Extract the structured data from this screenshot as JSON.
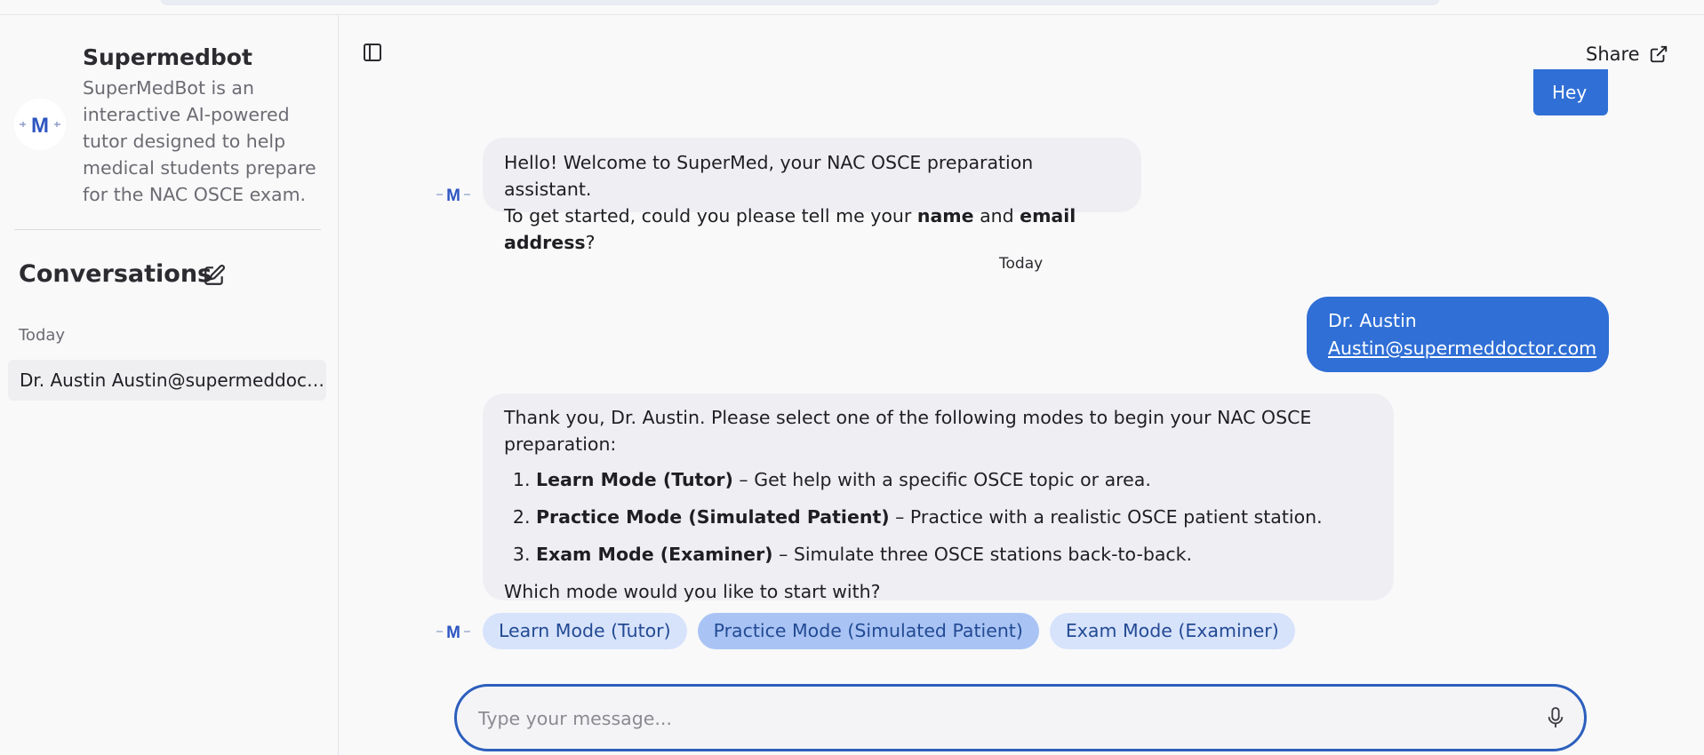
{
  "sidebar": {
    "bot_name": "Supermedbot",
    "bot_description": "SuperMedBot is an interactive AI-powered tutor designed to help medical students prepare for the NAC OSCE exam.",
    "logo_letter": "M",
    "conversations_title": "Conversations",
    "group_label": "Today",
    "conversation_item": "Dr. Austin Austin@supermeddoctor.com"
  },
  "header": {
    "share_label": "Share"
  },
  "chat": {
    "user_msg_top": "Hey",
    "bot_msg_1": {
      "line1": "Hello! Welcome to SuperMed, your NAC OSCE preparation assistant.",
      "line2_prefix": "To get started, could you please tell me your ",
      "bold_name": "name",
      "and": " and ",
      "bold_email": "email address",
      "suffix": "?"
    },
    "day_separator": "Today",
    "user_msg_2": {
      "name": "Dr. Austin",
      "email": "Austin@supermeddoctor.com"
    },
    "bot_msg_2": {
      "intro": "Thank you, Dr. Austin. Please select one of the following modes to begin your NAC OSCE preparation:",
      "items": [
        {
          "title": "Learn Mode (Tutor)",
          "desc": " – Get help with a specific OSCE topic or area."
        },
        {
          "title": "Practice Mode (Simulated Patient)",
          "desc": " – Practice with a realistic OSCE patient station."
        },
        {
          "title": "Exam Mode (Examiner)",
          "desc": " – Simulate three OSCE stations back-to-back."
        }
      ],
      "outro": "Which mode would you like to start with?"
    },
    "chips": [
      "Learn Mode (Tutor)",
      "Practice Mode (Simulated Patient)",
      "Exam Mode (Examiner)"
    ]
  },
  "composer": {
    "placeholder": "Type your message..."
  },
  "colors": {
    "accent": "#2f6fd6",
    "chip_bg": "#d7e3fb",
    "chip_active_bg": "#a9c4f4"
  },
  "icons": {
    "sidebar_toggle": "sidebar-toggle-icon",
    "edit": "edit-icon",
    "share": "external-link-icon",
    "mic": "microphone-icon"
  }
}
